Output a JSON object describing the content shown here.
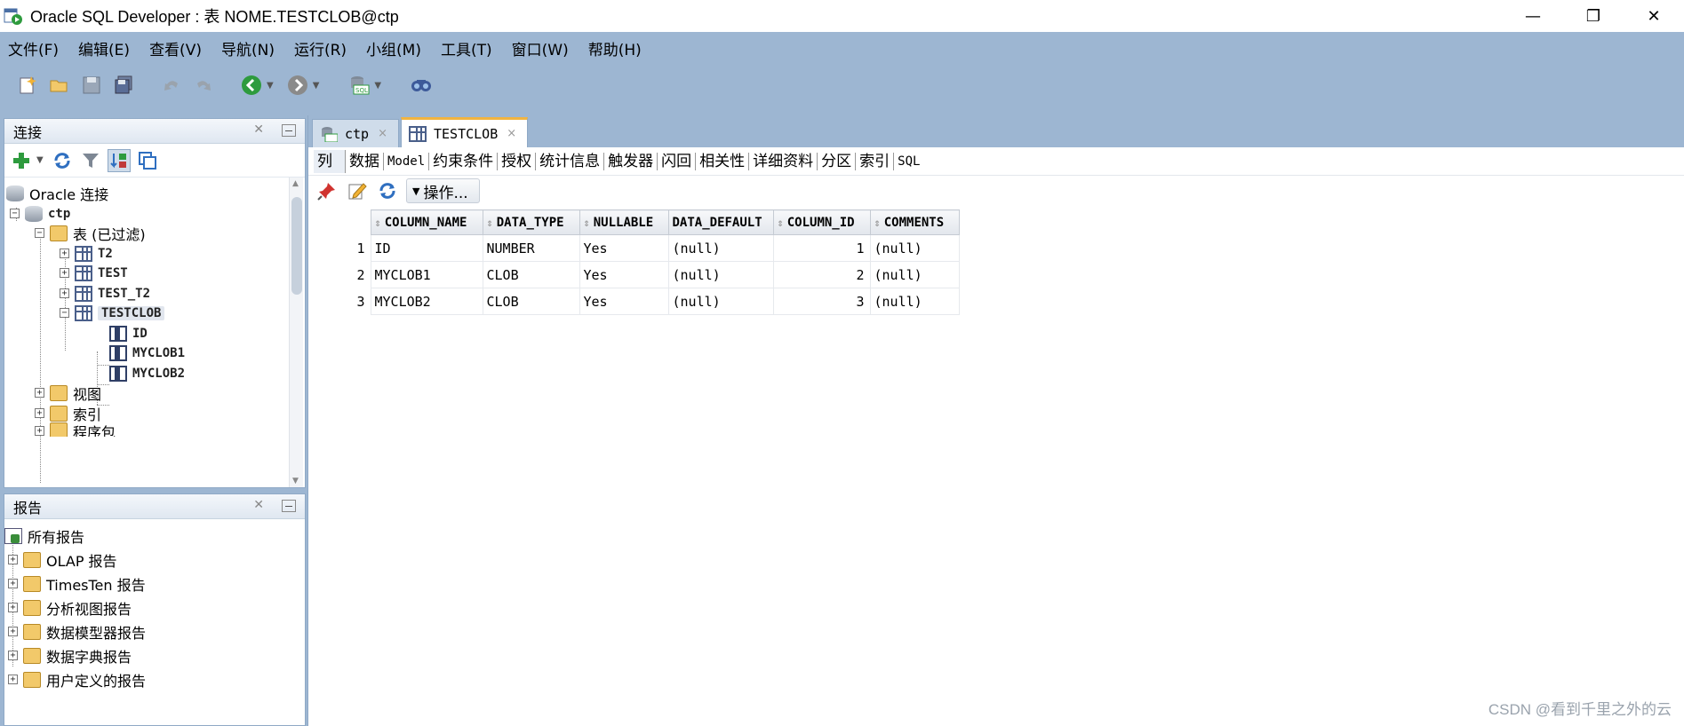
{
  "window": {
    "title": "Oracle SQL Developer : 表 NOME.TESTCLOB@ctp",
    "controls": {
      "minimize": "—",
      "restore": "❐",
      "close": "✕"
    }
  },
  "menu": [
    "文件(F)",
    "编辑(E)",
    "查看(V)",
    "导航(N)",
    "运行(R)",
    "小组(M)",
    "工具(T)",
    "窗口(W)",
    "帮助(H)"
  ],
  "toolbar": {
    "icons": [
      "new-icon",
      "open-icon",
      "save-icon",
      "save-all-icon",
      "undo-icon",
      "redo-icon",
      "back-icon",
      "forward-icon",
      "sql-worksheet-icon",
      "find-icon"
    ],
    "colors": {
      "back": "#2e9b3e",
      "forward": "#8a8a8a",
      "new": "#f2b233"
    }
  },
  "connections_panel": {
    "title": "连接",
    "tools": [
      "add-connection-icon",
      "refresh-icon",
      "filter-icon",
      "schema-browser-icon",
      "sql-icon"
    ],
    "tree": {
      "root": "Oracle 连接",
      "connection": "ctp",
      "tables_folder": "表 (已过滤)",
      "tables": [
        "T2",
        "TEST",
        "TEST_T2",
        "TESTCLOB"
      ],
      "columns": [
        "ID",
        "MYCLOB1",
        "MYCLOB2"
      ],
      "folders": [
        "视图",
        "索引",
        "程序包"
      ]
    }
  },
  "reports_panel": {
    "title": "报告",
    "root": "所有报告",
    "items": [
      "OLAP 报告",
      "TimesTen 报告",
      "分析视图报告",
      "数据模型器报告",
      "数据字典报告",
      "用户定义的报告"
    ]
  },
  "editor": {
    "tabs": [
      {
        "label": "ctp",
        "close": "×"
      },
      {
        "label": "TESTCLOB",
        "close": "×"
      }
    ],
    "sub_tabs": [
      "列",
      "数据",
      "Model",
      "约束条件",
      "授权",
      "统计信息",
      "触发器",
      "闪回",
      "相关性",
      "详细资料",
      "分区",
      "索引",
      "SQL"
    ],
    "actions_label": "操作...",
    "grid": {
      "headers": [
        "COLUMN_NAME",
        "DATA_TYPE",
        "NULLABLE",
        "DATA_DEFAULT",
        "COLUMN_ID",
        "COMMENTS"
      ],
      "rows": [
        [
          "1",
          "ID",
          "NUMBER",
          "Yes",
          "(null)",
          "1",
          "(null)"
        ],
        [
          "2",
          "MYCLOB1",
          "CLOB",
          "Yes",
          "(null)",
          "2",
          "(null)"
        ],
        [
          "3",
          "MYCLOB2",
          "CLOB",
          "Yes",
          "(null)",
          "3",
          "(null)"
        ]
      ]
    }
  },
  "watermark": "CSDN @看到千里之外的云"
}
